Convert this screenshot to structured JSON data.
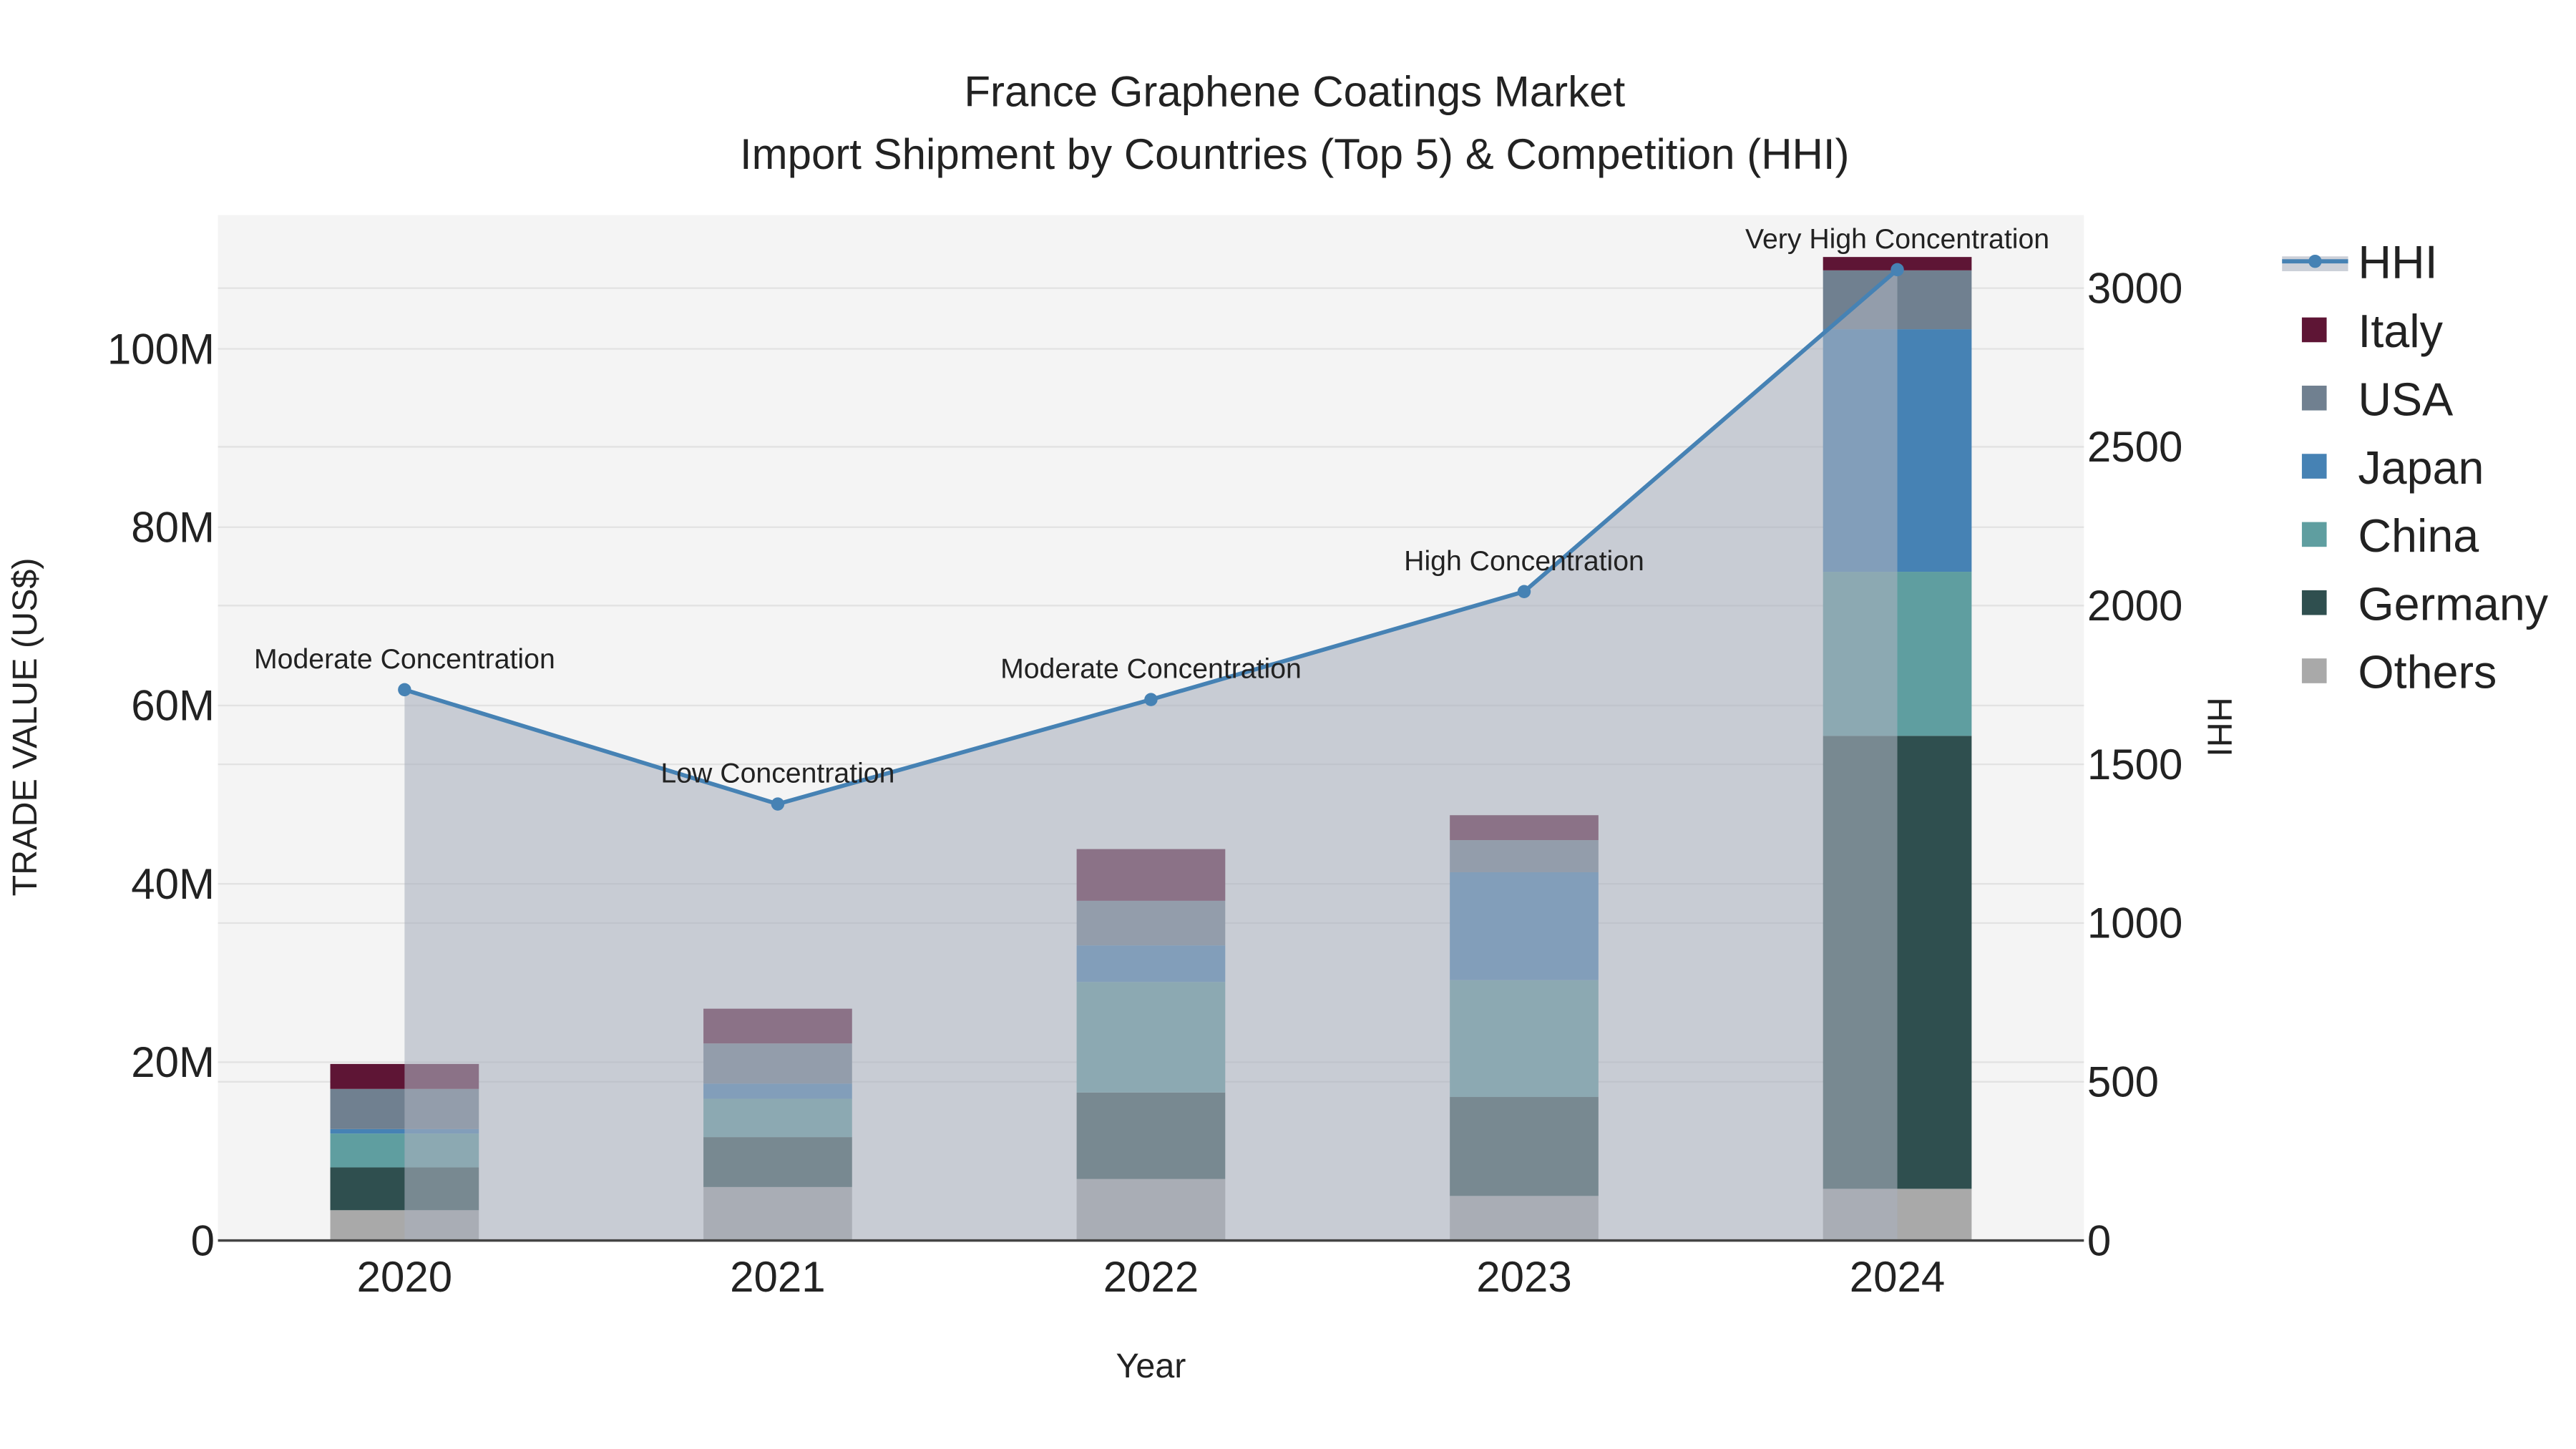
{
  "chart_data": {
    "type": "bar",
    "title": "France Graphene Coatings Market",
    "subtitle": "Import Shipment by Countries (Top 5) & Competition (HHI)",
    "xlabel": "Year",
    "ylabel": "TRADE VALUE (US$)",
    "y2label": "HHI",
    "categories": [
      "2020",
      "2021",
      "2022",
      "2023",
      "2024"
    ],
    "ylim": [
      0,
      115000000
    ],
    "y2lim": [
      0,
      3230
    ],
    "yticks": [
      0,
      20000000,
      40000000,
      60000000,
      80000000,
      100000000
    ],
    "ytick_labels": [
      "0",
      "20M",
      "40M",
      "60M",
      "80M",
      "100M"
    ],
    "y2ticks": [
      0,
      500,
      1000,
      1500,
      2000,
      2500,
      3000
    ],
    "y2tick_labels": [
      "0",
      "500",
      "1000",
      "1500",
      "2000",
      "2500",
      "3000"
    ],
    "series": [
      {
        "name": "Others",
        "color": "#a9a9a9",
        "values": [
          3400000,
          6000000,
          6900000,
          5000000,
          5800000
        ]
      },
      {
        "name": "Germany",
        "color": "#2f4f4f",
        "values": [
          4800000,
          5600000,
          9700000,
          11100000,
          50800000
        ]
      },
      {
        "name": "China",
        "color": "#5f9ea0",
        "values": [
          3800000,
          4300000,
          12400000,
          13100000,
          18400000
        ]
      },
      {
        "name": "Japan",
        "color": "#4682b4",
        "values": [
          500000,
          1700000,
          4100000,
          12100000,
          27200000
        ]
      },
      {
        "name": "USA",
        "color": "#708090",
        "values": [
          4500000,
          4500000,
          5000000,
          3600000,
          6600000
        ]
      },
      {
        "name": "Italy",
        "color": "#5e1535",
        "values": [
          2800000,
          3900000,
          5800000,
          2800000,
          1500000
        ]
      }
    ],
    "hhi": {
      "name": "HHI",
      "color": "#4682b4",
      "values": [
        1735,
        1375,
        1704,
        2044,
        3058
      ],
      "annotations": [
        "Moderate Concentration",
        "Low Concentration",
        "Moderate Concentration",
        "High Concentration",
        "Very High Concentration"
      ]
    },
    "legend": [
      "HHI",
      "Italy",
      "USA",
      "Japan",
      "China",
      "Germany",
      "Others"
    ],
    "legend_placement": "right",
    "grid": true
  }
}
